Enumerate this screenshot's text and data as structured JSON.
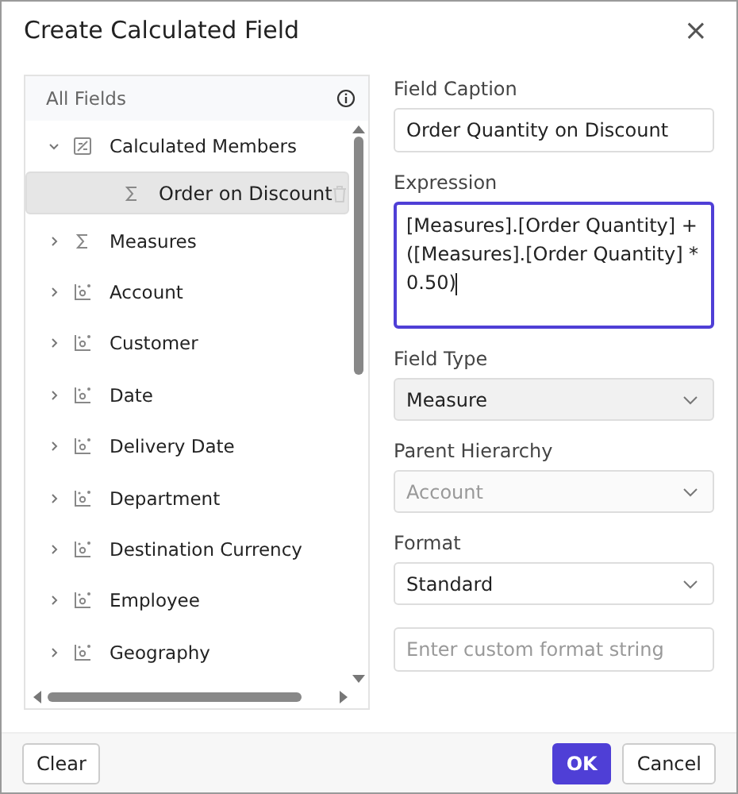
{
  "dialog": {
    "title": "Create Calculated Field",
    "close": "×"
  },
  "tree": {
    "header": "All Fields",
    "items": [
      {
        "label": "Calculated Members",
        "kind": "folder",
        "expanded": true,
        "selected": false,
        "children": [
          {
            "label": "Order on Discount",
            "kind": "measure",
            "selected": true,
            "deletable": true
          }
        ]
      },
      {
        "label": "Measures",
        "kind": "measure",
        "expanded": false,
        "selected": false
      },
      {
        "label": "Account",
        "kind": "hierarchy",
        "expanded": false,
        "selected": false
      },
      {
        "label": "Customer",
        "kind": "hierarchy",
        "expanded": false,
        "selected": false
      },
      {
        "label": "Date",
        "kind": "hierarchy",
        "expanded": false,
        "selected": false
      },
      {
        "label": "Delivery Date",
        "kind": "hierarchy",
        "expanded": false,
        "selected": false
      },
      {
        "label": "Department",
        "kind": "hierarchy",
        "expanded": false,
        "selected": false
      },
      {
        "label": "Destination Currency",
        "kind": "hierarchy",
        "expanded": false,
        "selected": false
      },
      {
        "label": "Employee",
        "kind": "hierarchy",
        "expanded": false,
        "selected": false
      },
      {
        "label": "Geography",
        "kind": "hierarchy",
        "expanded": false,
        "selected": false
      }
    ]
  },
  "form": [
    {
      "kind": "text",
      "label": "Field Caption",
      "value": "Order Quantity on Discount"
    },
    {
      "kind": "textarea",
      "label": "Expression",
      "value": "[Measures].[Order Quantity] + ([Measures].[Order Quantity] * 0.50)",
      "focused": true
    },
    {
      "kind": "select",
      "label": "Field Type",
      "value": "Measure",
      "disabled": false,
      "shaded": true
    },
    {
      "kind": "select",
      "label": "Parent Hierarchy",
      "value": "Account",
      "disabled": true,
      "shaded": false
    },
    {
      "kind": "select",
      "label": "Format",
      "value": "Standard",
      "disabled": false,
      "shaded": false
    },
    {
      "kind": "text",
      "placeholder": "Enter custom format string"
    }
  ],
  "footer": {
    "clear": "Clear",
    "ok": "OK",
    "cancel": "Cancel"
  }
}
